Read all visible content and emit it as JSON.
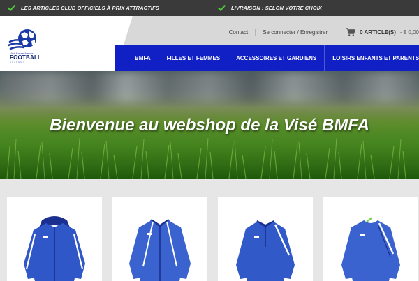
{
  "promo": {
    "items": [
      {
        "text": "LES ARTICLES CLUB OFFICIELS À PRIX ATTRACTIFS",
        "icon": "check-icon"
      },
      {
        "text": "LIVRAISON : SELON VOTRE CHOIX",
        "icon": "check-icon"
      }
    ],
    "accent": "#4cc63a"
  },
  "brand": {
    "logo_subtitle": "Visé-Basse-Meuse",
    "logo_title": "FOOTBALL",
    "logo_tagline": "ACADEMY",
    "colors": {
      "primary": "#1020c4",
      "dark": "#0b1e6e"
    }
  },
  "header": {
    "contact_label": "Contact",
    "login_label": "Se connecter / Enregistrer",
    "cart_count": "0 ARTICLE(S)",
    "cart_total": "- € 0,00",
    "cart_icon": "cart-icon"
  },
  "nav": {
    "items": [
      "BMFA",
      "FILLES ET FEMMES",
      "ACCESSOIRES ET GARDIENS",
      "LOISIRS ENFANTS ET PARENTS"
    ]
  },
  "hero": {
    "title": "Bienvenue au webshop de la Visé BMFA"
  },
  "products": {
    "items": [
      {
        "image": "hooded-zip-jacket-blue"
      },
      {
        "image": "zip-track-jacket-blue"
      },
      {
        "image": "half-zip-training-top-blue"
      },
      {
        "image": "crew-neck-sweatshirt-blue"
      }
    ]
  }
}
